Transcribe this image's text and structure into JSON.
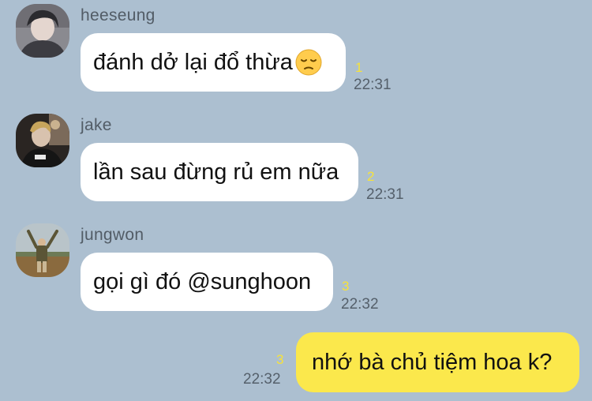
{
  "messages": [
    {
      "sender": "heeseung",
      "avatar_icon": "user-avatar-photo",
      "text": "đánh dở lại đổ thừa",
      "emoji": "pensive-face-emoji",
      "unread": "1",
      "time": "22:31"
    },
    {
      "sender": "jake",
      "avatar_icon": "user-avatar-photo",
      "text": "lần sau đừng rủ em nữa",
      "unread": "2",
      "time": "22:31"
    },
    {
      "sender": "jungwon",
      "avatar_icon": "user-avatar-photo",
      "text": "gọi gì đó @sunghoon",
      "unread": "3",
      "time": "22:32"
    }
  ],
  "my_message": {
    "text": "nhớ bà chủ tiệm hoa k?",
    "unread": "3",
    "time": "22:32"
  },
  "colors": {
    "background": "#acbfd0",
    "incoming_bubble": "#ffffff",
    "outgoing_bubble": "#fbe84c",
    "unread_count": "#f7e23a",
    "timestamp": "#55606b"
  }
}
